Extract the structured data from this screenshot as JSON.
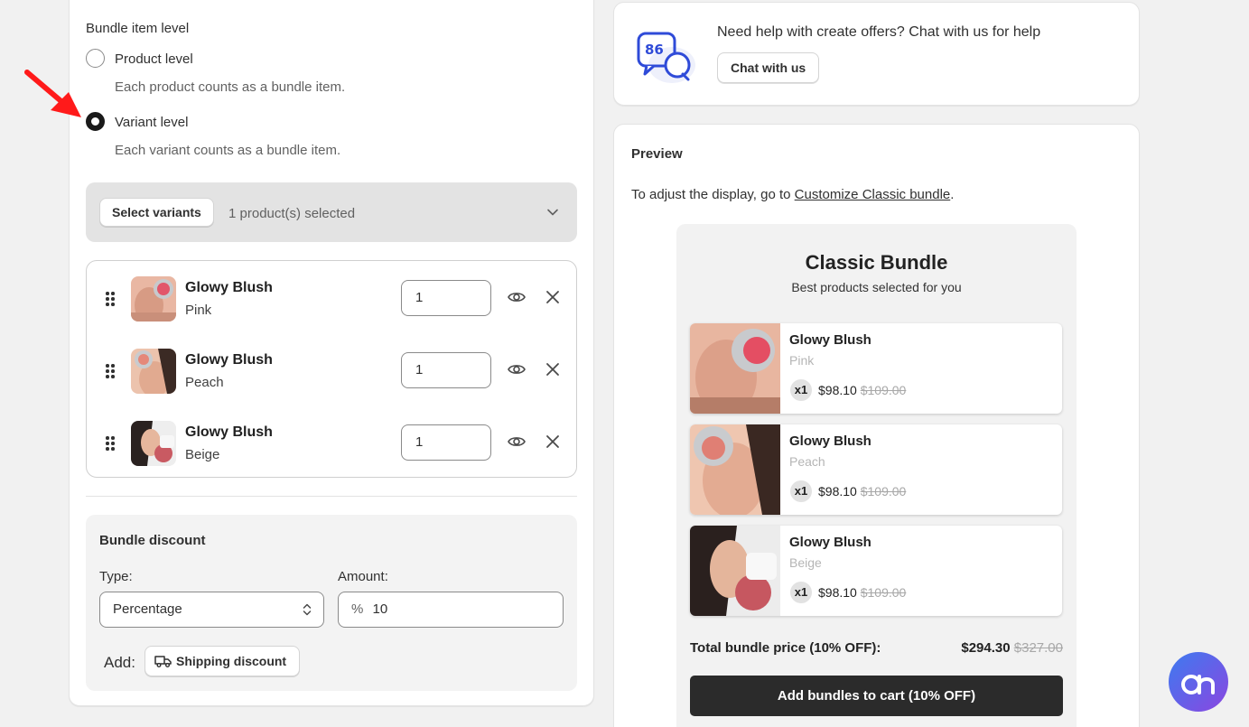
{
  "bundle_level": {
    "title": "Bundle item level",
    "options": [
      {
        "label": "Product level",
        "help": "Each product counts as a bundle item.",
        "selected": false
      },
      {
        "label": "Variant level",
        "help": "Each variant counts as a bundle item.",
        "selected": true
      }
    ]
  },
  "selector": {
    "button_label": "Select variants",
    "status": "1 product(s) selected"
  },
  "items": [
    {
      "name": "Glowy Blush",
      "variant": "Pink",
      "quantity": "1"
    },
    {
      "name": "Glowy Blush",
      "variant": "Peach",
      "quantity": "1"
    },
    {
      "name": "Glowy Blush",
      "variant": "Beige",
      "quantity": "1"
    }
  ],
  "discount": {
    "title": "Bundle discount",
    "type_label": "Type:",
    "type_value": "Percentage",
    "amount_label": "Amount:",
    "amount_prefix": "%",
    "amount_value": "10",
    "add_label": "Add:",
    "shipping_button": "Shipping discount"
  },
  "help": {
    "text": "Need help with create offers? Chat with us for help",
    "button": "Chat with us"
  },
  "preview": {
    "heading": "Preview",
    "hint_prefix": "To adjust the display, go to ",
    "hint_link": "Customize Classic bundle",
    "hint_suffix": ".",
    "bundle_title": "Classic Bundle",
    "bundle_subtitle": "Best products selected for you",
    "products": [
      {
        "name": "Glowy Blush",
        "variant": "Pink",
        "qty": "x1",
        "price": "$98.10",
        "compare_price": "$109.00"
      },
      {
        "name": "Glowy Blush",
        "variant": "Peach",
        "qty": "x1",
        "price": "$98.10",
        "compare_price": "$109.00"
      },
      {
        "name": "Glowy Blush",
        "variant": "Beige",
        "qty": "x1",
        "price": "$98.10",
        "compare_price": "$109.00"
      }
    ],
    "total_label": "Total bundle price (10% OFF):",
    "total_price": "$294.30",
    "total_compare": "$327.00",
    "cart_button": "Add bundles to cart (10% OFF)"
  },
  "colors": {
    "annotation_arrow": "#ff1a1a",
    "cart_button": "#2b2b2b",
    "chat_icon": "#2f4bd8",
    "app_badge": "#5b5be8"
  },
  "icons": [
    "arrow-annotation-icon",
    "chevron-down-icon",
    "drag-handle-icon",
    "eye-icon",
    "close-icon",
    "select-arrows-icon",
    "truck-icon",
    "chat-icon",
    "app-logo-icon"
  ]
}
